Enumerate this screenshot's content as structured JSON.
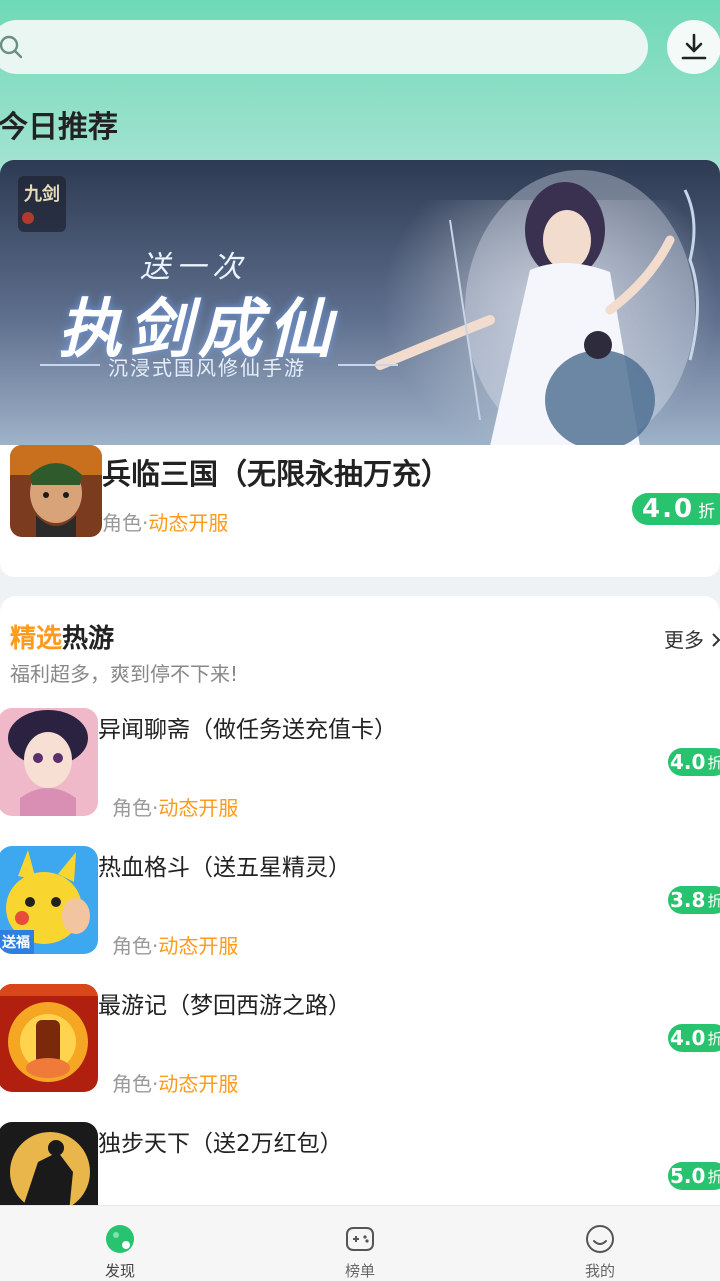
{
  "search": {
    "placeholder": ""
  },
  "today": {
    "title": "今日推荐"
  },
  "banner": {
    "small_text": "送一次",
    "big_text": "执剑成仙",
    "sub_text": "沉浸式国风修仙手游",
    "logo_text": "九剑"
  },
  "featured": {
    "name": "兵临三国（无限永抽万充）",
    "tag_category": "角色",
    "tag_sep": "·",
    "tag_highlight": "动态开服",
    "discount_value": "4.0",
    "discount_unit": "折"
  },
  "hot": {
    "title_highlight": "精选",
    "title_rest": "热游",
    "subtitle": "福利超多，爽到停不下来!",
    "more_label": "更多",
    "more_icon": "chevron-right-icon",
    "games": [
      {
        "name": "异闻聊斋（做任务送充值卡）",
        "tag_category": "角色",
        "tag_sep": "·",
        "tag_highlight": "动态开服",
        "discount_value": "4.0",
        "discount_unit": "折"
      },
      {
        "name": "热血格斗（送五星精灵）",
        "tag_category": "角色",
        "tag_sep": "·",
        "tag_highlight": "动态开服",
        "discount_value": "3.8",
        "discount_unit": "折",
        "icon_badge": "送福"
      },
      {
        "name": "最游记（梦回西游之路）",
        "tag_category": "角色",
        "tag_sep": "·",
        "tag_highlight": "动态开服",
        "discount_value": "4.0",
        "discount_unit": "折"
      },
      {
        "name": "独步天下（送2万红包）",
        "discount_value": "5.0",
        "discount_unit": "折"
      }
    ]
  },
  "tabs": [
    {
      "label": "发现",
      "icon": "discover-icon",
      "active": true
    },
    {
      "label": "榜单",
      "icon": "gamepad-icon",
      "active": false
    },
    {
      "label": "我的",
      "icon": "smiley-icon",
      "active": false
    }
  ],
  "colors": {
    "accent_green": "#27c36e",
    "highlight_orange": "#ff9a1a",
    "header_gradient_top": "#6fd9b6"
  }
}
